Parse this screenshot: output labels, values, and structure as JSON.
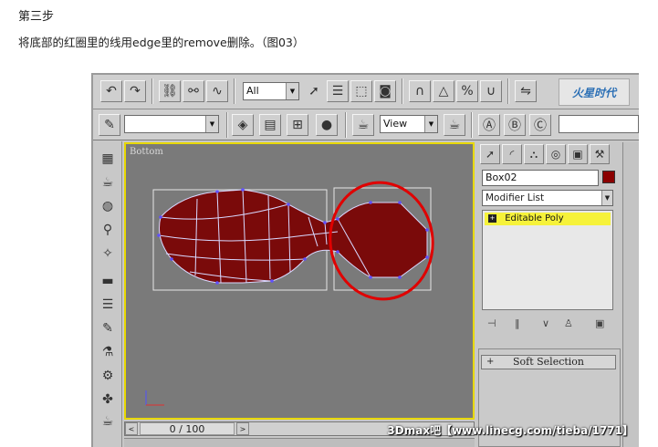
{
  "step": {
    "title": "第三步",
    "description": "将底部的红圈里的线用edge里的remove删除。（图03）"
  },
  "toolbar": {
    "selection_filter": "All",
    "view_dropdown": "View",
    "logo_text": "火星时代"
  },
  "viewport": {
    "label": "Bottom",
    "mesh_color": "#7a0a0a",
    "highlight_color": "#e00000",
    "border_color": "#e8d800"
  },
  "timeline": {
    "prev": "<",
    "next": ">",
    "value": "0 / 100"
  },
  "command_panel": {
    "object_name": "Box02",
    "object_color": "#8b0000",
    "modifier_list": "Modifier List",
    "stack_item": "Editable Poly",
    "rollout": "Soft Selection"
  },
  "watermark": "3Dmax吧【www.linecg.com/tieba/1771】"
}
